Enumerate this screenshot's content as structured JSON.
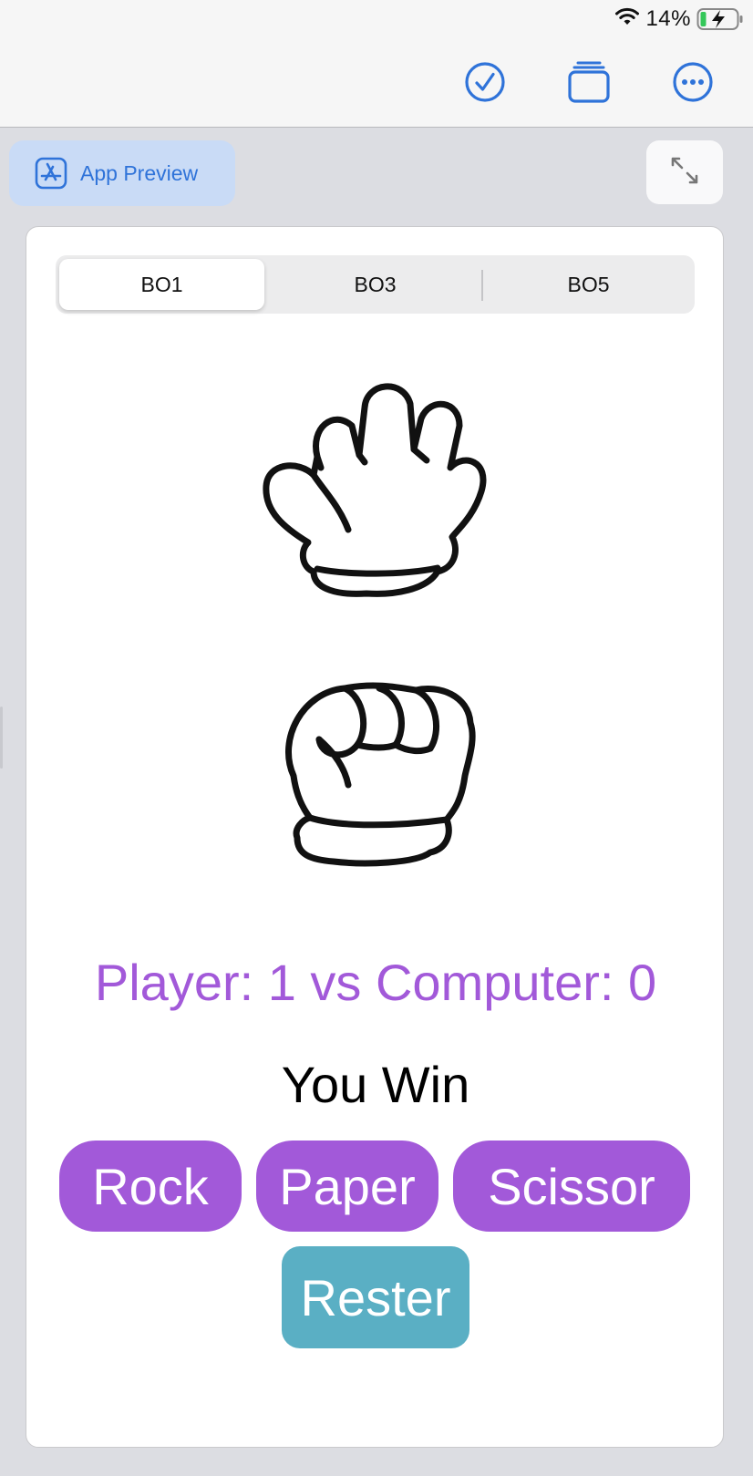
{
  "status_bar": {
    "battery_percent": "14%",
    "wifi_icon": "wifi-icon",
    "battery_icon": "battery-charging-icon"
  },
  "toolbar": {
    "icons": [
      "checkmark-circle-icon",
      "stacked-windows-icon",
      "more-ellipsis-icon"
    ],
    "accent_color": "#2f73d9"
  },
  "preview_header": {
    "app_preview_label": "App Preview",
    "app_preview_icon": "app-store-icon",
    "expand_icon": "expand-arrows-icon"
  },
  "game": {
    "modes": [
      "BO1",
      "BO3",
      "BO5"
    ],
    "selected_mode": "BO1",
    "computer_choice_icon": "open-hand-paper-icon",
    "player_choice_icon": "fist-rock-icon",
    "score_text": "Player: 1 vs Computer: 0",
    "result_text": "You Win",
    "buttons": {
      "rock": "Rock",
      "paper": "Paper",
      "scissor": "Scissor",
      "reset": "Rester"
    },
    "colors": {
      "primary": "#a259d9",
      "reset": "#5aafc4"
    }
  }
}
